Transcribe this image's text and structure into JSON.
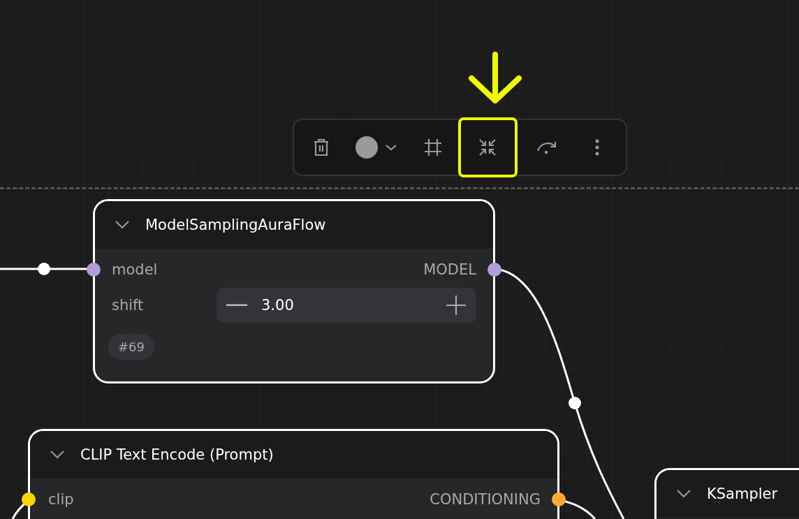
{
  "toolbar": {
    "buttons": [
      {
        "kind": "delete",
        "highlighted": false
      },
      {
        "kind": "color",
        "highlighted": false
      },
      {
        "kind": "frame",
        "highlighted": false
      },
      {
        "kind": "collapse",
        "highlighted": true
      },
      {
        "kind": "bypass",
        "highlighted": false
      },
      {
        "kind": "more",
        "highlighted": false
      }
    ]
  },
  "nodes": [
    {
      "title": "ModelSamplingAuraFlow",
      "selected": true,
      "expanded": true,
      "inputs": [
        {
          "label": "model",
          "color": "#b39ddb"
        }
      ],
      "outputs": [
        {
          "label": "MODEL",
          "color": "#b39ddb"
        }
      ],
      "widgets": [
        {
          "label": "shift",
          "value": "3.00"
        }
      ],
      "badge": "#69"
    },
    {
      "title": "CLIP Text Encode (Prompt)",
      "selected": true,
      "expanded": true,
      "inputs": [
        {
          "label": "clip",
          "color": "#ffd500"
        }
      ],
      "outputs": [
        {
          "label": "CONDITIONING",
          "color": "#ffa931"
        }
      ]
    },
    {
      "title": "KSampler",
      "selected": true,
      "expanded": true
    }
  ]
}
